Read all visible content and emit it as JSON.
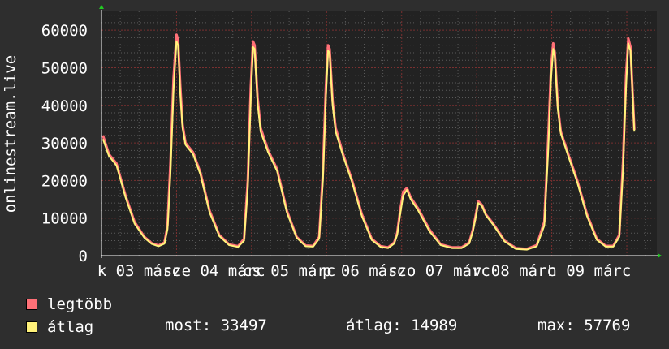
{
  "chart_data": {
    "type": "line",
    "title": "",
    "ylabel": "onlinestream.live",
    "xlabel": "",
    "ylim": [
      0,
      65000
    ],
    "y_ticks": [
      "0",
      "10000",
      "20000",
      "30000",
      "40000",
      "50000",
      "60000"
    ],
    "x_tick_labels": [
      "k 03 márc",
      "sze 04 márc",
      "cs 05 márc",
      "p 06 márc",
      "szo 07 márc",
      "v 08 márc",
      "h 09 márc"
    ],
    "grid": true,
    "colors": {
      "max": "#ff7077",
      "avg": "#fff27a",
      "grid": "#5a5a5a",
      "axis": "#ffffff",
      "plot_bg": "#222222"
    },
    "series": [
      {
        "name": "legtöbb",
        "color": "#ff7077",
        "x": [
          0,
          0.08,
          0.18,
          0.3,
          0.42,
          0.55,
          0.65,
          0.74,
          0.82,
          0.86,
          0.9,
          0.94,
          0.98,
          1.0,
          1.03,
          1.06,
          1.1,
          1.2,
          1.3,
          1.42,
          1.55,
          1.68,
          1.8,
          1.88,
          1.93,
          1.97,
          2.0,
          2.02,
          2.06,
          2.1,
          2.2,
          2.32,
          2.45,
          2.58,
          2.7,
          2.8,
          2.88,
          2.93,
          2.97,
          3.0,
          3.02,
          3.06,
          3.1,
          3.2,
          3.32,
          3.45,
          3.58,
          3.7,
          3.8,
          3.88,
          3.92,
          3.96,
          4.0,
          4.05,
          4.1,
          4.2,
          4.35,
          4.5,
          4.65,
          4.78,
          4.88,
          4.93,
          4.97,
          5.0,
          5.05,
          5.1,
          5.2,
          5.35,
          5.5,
          5.65,
          5.78,
          5.88,
          5.93,
          5.97,
          6.0,
          6.02,
          6.06,
          6.1,
          6.2,
          6.32,
          6.45,
          6.58,
          6.7,
          6.8,
          6.88,
          6.93,
          6.97,
          7.0,
          7.03,
          7.08
        ],
        "values": [
          32000,
          27000,
          24500,
          16000,
          9000,
          5000,
          3300,
          2700,
          3500,
          8000,
          25000,
          47000,
          58800,
          57500,
          45000,
          35000,
          30000,
          27500,
          22000,
          12000,
          5500,
          3000,
          2500,
          4500,
          20000,
          45000,
          57000,
          56000,
          42000,
          34000,
          28000,
          23000,
          12000,
          5000,
          2700,
          2600,
          5000,
          22000,
          45000,
          56000,
          55000,
          41000,
          34000,
          27000,
          20000,
          11000,
          4500,
          2500,
          2200,
          3500,
          6000,
          12000,
          17000,
          18000,
          15500,
          12500,
          7000,
          3000,
          2200,
          2200,
          3500,
          7000,
          11000,
          14500,
          13500,
          11000,
          8500,
          4000,
          2000,
          1800,
          2800,
          9000,
          30000,
          50000,
          56500,
          54000,
          40000,
          33000,
          27000,
          20000,
          11000,
          4500,
          2600,
          2600,
          5500,
          25000,
          48000,
          57800,
          55500,
          33500
        ]
      },
      {
        "name": "átlag",
        "color": "#fff27a",
        "x": [
          0,
          0.08,
          0.18,
          0.3,
          0.42,
          0.55,
          0.65,
          0.74,
          0.82,
          0.86,
          0.9,
          0.94,
          0.98,
          1.0,
          1.03,
          1.06,
          1.1,
          1.2,
          1.3,
          1.42,
          1.55,
          1.68,
          1.8,
          1.88,
          1.93,
          1.97,
          2.0,
          2.02,
          2.06,
          2.1,
          2.2,
          2.32,
          2.45,
          2.58,
          2.7,
          2.8,
          2.88,
          2.93,
          2.97,
          3.0,
          3.02,
          3.06,
          3.1,
          3.2,
          3.32,
          3.45,
          3.58,
          3.7,
          3.8,
          3.88,
          3.92,
          3.96,
          4.0,
          4.05,
          4.1,
          4.2,
          4.35,
          4.5,
          4.65,
          4.78,
          4.88,
          4.93,
          4.97,
          5.0,
          5.05,
          5.1,
          5.2,
          5.35,
          5.5,
          5.65,
          5.78,
          5.88,
          5.93,
          5.97,
          6.0,
          6.02,
          6.06,
          6.1,
          6.2,
          6.32,
          6.45,
          6.58,
          6.7,
          6.8,
          6.88,
          6.93,
          6.97,
          7.0,
          7.03,
          7.08
        ],
        "values": [
          31000,
          26500,
          24000,
          15500,
          8500,
          4800,
          3100,
          2500,
          3200,
          7000,
          22000,
          44000,
          57000,
          56000,
          43000,
          34000,
          29500,
          27000,
          21500,
          11500,
          5200,
          2800,
          2300,
          4000,
          18000,
          42000,
          55500,
          55000,
          40500,
          33000,
          27500,
          22500,
          11500,
          4800,
          2500,
          2400,
          4500,
          20000,
          42000,
          54500,
          54000,
          40000,
          33000,
          26500,
          19500,
          10500,
          4200,
          2300,
          2000,
          3200,
          5500,
          11000,
          16000,
          17500,
          15000,
          12000,
          6500,
          2800,
          2000,
          2000,
          3200,
          6500,
          10500,
          14000,
          13200,
          10800,
          8200,
          3800,
          1800,
          1600,
          2500,
          8000,
          27000,
          47000,
          55000,
          53000,
          39000,
          32500,
          26500,
          19500,
          10500,
          4200,
          2400,
          2400,
          5000,
          23000,
          45000,
          56500,
          54500,
          33000
        ]
      }
    ]
  },
  "legend": [
    {
      "label": "legtöbb",
      "color": "#ff7077"
    },
    {
      "label": "átlag",
      "color": "#fff27a"
    }
  ],
  "stats": {
    "most": "most: 33497",
    "atlag": "átlag: 14989",
    "max": "max: 57769"
  }
}
